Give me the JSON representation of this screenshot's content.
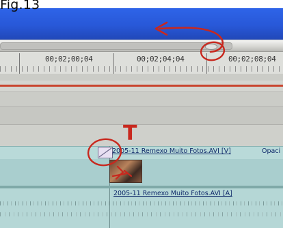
{
  "caption": "Fig.13",
  "ruler": {
    "timecodes": [
      "00;02;00;04",
      "00;02;04;04",
      "00;02;08;04"
    ]
  },
  "video_track": {
    "clip_name": "2005-11 Remexo Muito Fotos.AVI [V]",
    "opacity_label": "Opaci"
  },
  "audio_track": {
    "clip_name": "2005-11 Remexo Muito Fotos.AVI [A]"
  },
  "annotations": {
    "letter": "T"
  },
  "colors": {
    "title_bar": "#2e64e8",
    "annotation": "#c8281e",
    "video_track": "#a9cece",
    "audio_track": "#b5d7d6"
  }
}
